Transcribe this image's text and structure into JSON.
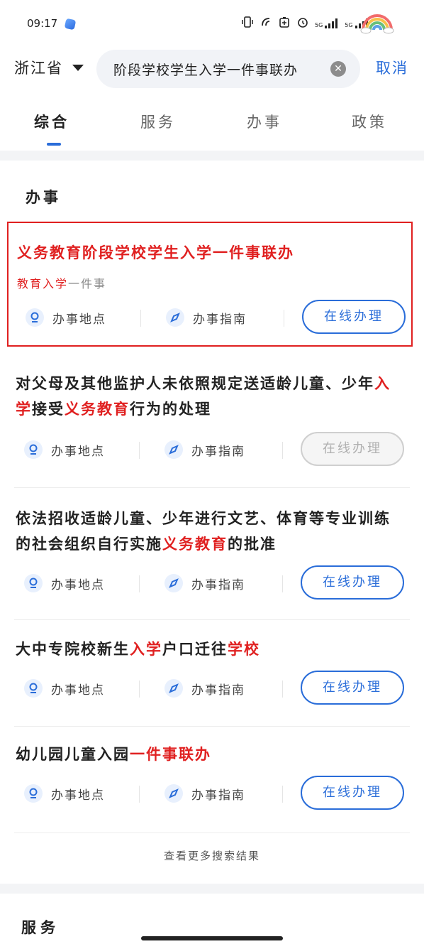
{
  "status_bar": {
    "time": "09:17",
    "icons": [
      "vibrate-icon",
      "nfc-icon",
      "battery-saver-icon",
      "alarm-icon",
      "5g-signal-icon",
      "5g-signal-icon-2"
    ],
    "signal_label_1": "5G",
    "signal_label_2": "5G"
  },
  "search": {
    "province": "浙江省",
    "query": "阶段学校学生入学一件事联办",
    "cancel_label": "取消"
  },
  "tabs": [
    {
      "label": "综合",
      "active": true
    },
    {
      "label": "服务",
      "active": false
    },
    {
      "label": "办事",
      "active": false
    },
    {
      "label": "政策",
      "active": false
    }
  ],
  "section": {
    "title": "办事"
  },
  "actions": {
    "location_label": "办事地点",
    "guide_label": "办事指南",
    "online_label": "在线办理"
  },
  "results": [
    {
      "title_parts": [
        {
          "text": "义务教育阶段学校学生入学一件事联办",
          "hl": true
        }
      ],
      "subtitle_parts": [
        {
          "text": "教育入学",
          "hl": true
        },
        {
          "text": "一件事",
          "hl": false
        }
      ],
      "online_enabled": true,
      "highlighted": true
    },
    {
      "title_parts": [
        {
          "text": "对父母及其他监护人未依照规定送适龄儿童、少年",
          "hl": false
        },
        {
          "text": "入学",
          "hl": true
        },
        {
          "text": "接受",
          "hl": false
        },
        {
          "text": "义务教育",
          "hl": true
        },
        {
          "text": "行为的处理",
          "hl": false
        }
      ],
      "online_enabled": false,
      "highlighted": false
    },
    {
      "title_parts": [
        {
          "text": "依法招收适龄儿童、少年进行文艺、体育等专业训练的社会组织自行实施",
          "hl": false
        },
        {
          "text": "义务教育",
          "hl": true
        },
        {
          "text": "的批准",
          "hl": false
        }
      ],
      "online_enabled": true,
      "highlighted": false
    },
    {
      "title_parts": [
        {
          "text": "大中专院校新生",
          "hl": false
        },
        {
          "text": "入学",
          "hl": true
        },
        {
          "text": "户口迁往",
          "hl": false
        },
        {
          "text": "学校",
          "hl": true
        }
      ],
      "online_enabled": true,
      "highlighted": false
    },
    {
      "title_parts": [
        {
          "text": "幼儿园儿童入园",
          "hl": false
        },
        {
          "text": "一件事联办",
          "hl": true
        }
      ],
      "online_enabled": true,
      "highlighted": false
    }
  ],
  "more_label": "查看更多搜索结果",
  "next_section": {
    "title": "服务"
  },
  "colors": {
    "accent": "#2a6dd9",
    "highlight": "#e02020"
  }
}
